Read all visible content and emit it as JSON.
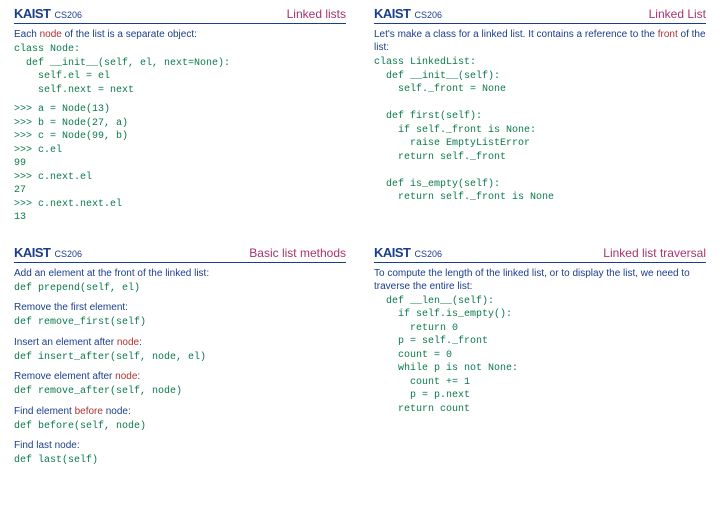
{
  "logo": "KAIST",
  "course": "CS206",
  "slides": [
    {
      "title": "Linked lists",
      "intro_pre": "Each ",
      "intro_kw": "node",
      "intro_post": " of the list is a separate object:",
      "code1": "class Node:\n  def __init__(self, el, next=None):\n    self.el = el\n    self.next = next",
      "code2": ">>> a = Node(13)\n>>> b = Node(27, a)\n>>> c = Node(99, b)\n>>> c.el\n99\n>>> c.next.el\n27\n>>> c.next.next.el\n13"
    },
    {
      "title": "Linked List",
      "intro_pre": "Let's make a class for a linked list. It contains a reference to the ",
      "intro_kw": "front",
      "intro_post": " of the list:",
      "code1": "class LinkedList:\n  def __init__(self):\n    self._front = None\n\n  def first(self):\n    if self._front is None:\n      raise EmptyListError\n    return self._front\n\n  def is_empty(self):\n    return self._front is None"
    },
    {
      "title": "Basic list methods",
      "items": [
        {
          "text": "Add an element at the front of the linked list:",
          "kw": "",
          "post": "",
          "code": "def prepend(self, el)"
        },
        {
          "text": "Remove the first element:",
          "kw": "",
          "post": "",
          "code": "def remove_first(self)"
        },
        {
          "text": "Insert an element after ",
          "kw": "node",
          "post": ":",
          "code": "def insert_after(self, node, el)"
        },
        {
          "text": "Remove element after ",
          "kw": "node",
          "post": ":",
          "code": "def remove_after(self, node)"
        },
        {
          "text": "Find element ",
          "kw": "before",
          "post": " node:",
          "code": "def before(self, node)"
        },
        {
          "text": "Find last node:",
          "kw": "",
          "post": "",
          "code": "def last(self)"
        }
      ]
    },
    {
      "title": "Linked list traversal",
      "intro": "To compute the length of the linked list, or to display the list, we need to traverse the entire list:",
      "code1": "  def __len__(self):\n    if self.is_empty():\n      return 0\n    p = self._front\n    count = 0\n    while p is not None:\n      count += 1\n      p = p.next\n    return count"
    }
  ]
}
